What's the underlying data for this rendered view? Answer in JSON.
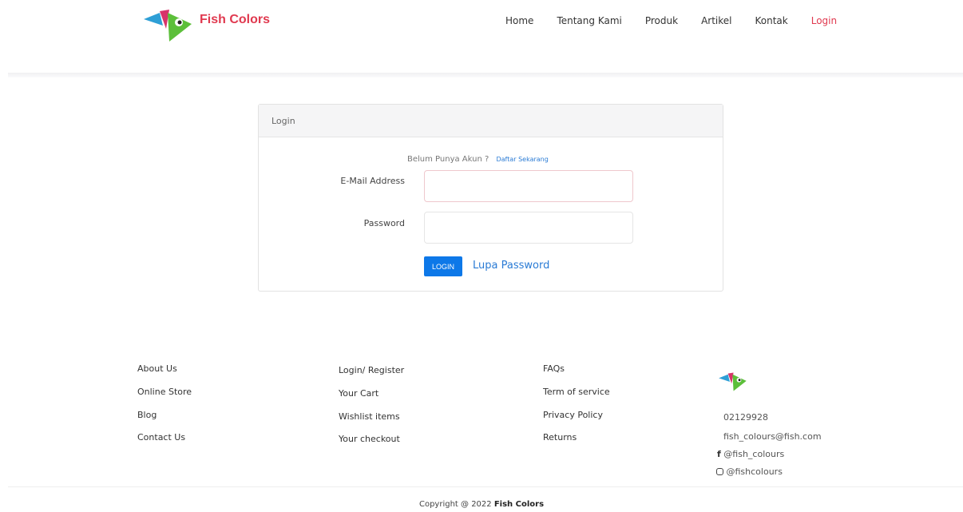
{
  "header": {
    "brand": "Fish Colors",
    "nav": [
      "Home",
      "Tentang Kami",
      "Produk",
      "Artikel",
      "Kontak",
      "Login"
    ]
  },
  "login_card": {
    "title": "Login",
    "register_prompt": "Belum Punya Akun ?",
    "register_link": "Daftar Sekarang",
    "email_label": "E-Mail Address",
    "email_value": "",
    "password_label": "Password",
    "password_value": "",
    "login_button": "LOGIN",
    "forgot_link": "Lupa Password"
  },
  "footer": {
    "col1": [
      "About Us",
      "Online Store",
      "Blog",
      "Contact Us"
    ],
    "col2": [
      "Login/ Register",
      "Your Cart",
      "Wishlist items",
      "Your checkout"
    ],
    "col3": [
      "FAQs",
      "Term of service",
      "Privacy Policy",
      "Returns"
    ],
    "contact": {
      "phone": "02129928",
      "email": "fish_colours@fish.com",
      "facebook": "@fish_colours",
      "instagram": "@fishcolours"
    },
    "copyright_prefix": "Copyright @ 2022",
    "copyright_brand": "Fish Colors"
  },
  "colors": {
    "accent": "#e0394f",
    "primary": "#0d78e8",
    "link": "#2a7bd5"
  }
}
